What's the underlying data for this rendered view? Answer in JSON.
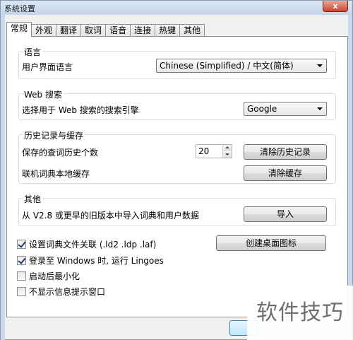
{
  "window": {
    "title": "系统设置",
    "close_glyph": "x"
  },
  "tabs": [
    {
      "label": "常规",
      "active": true
    },
    {
      "label": "外观",
      "active": false
    },
    {
      "label": "翻译",
      "active": false
    },
    {
      "label": "取词",
      "active": false
    },
    {
      "label": "语音",
      "active": false
    },
    {
      "label": "连接",
      "active": false
    },
    {
      "label": "热键",
      "active": false
    },
    {
      "label": "其他",
      "active": false
    }
  ],
  "language": {
    "group_title": "语言",
    "ui_language_label": "用户界面语言",
    "ui_language_value": "Chinese (Simplified)  /  中文(简体)"
  },
  "web_search": {
    "group_title": "Web 搜索",
    "engine_label": "选择用于 Web 搜索的搜索引擎",
    "engine_value": "Google"
  },
  "history": {
    "group_title": "历史记录与缓存",
    "history_count_label": "保存的查词历史个数",
    "history_count_value": "20",
    "clear_history_button": "清除历史记录",
    "cache_label": "联机词典本地缓存",
    "clear_cache_button": "清除缓存"
  },
  "other": {
    "group_title": "其他",
    "import_label": "从 V2.8 或更早的旧版本中导入词典和用户数据",
    "import_button": "导入"
  },
  "options": {
    "file_assoc_label": "设置词典文件关联 (.ld2 .ldp .laf)",
    "file_assoc_checked": true,
    "desktop_icon_button": "创建桌面图标",
    "run_on_login_label": "登录至 Windows 时, 运行 Lingoes",
    "run_on_login_checked": true,
    "minimize_label": "启动后最小化",
    "minimize_checked": false,
    "no_tips_label": "不显示信息提示窗口",
    "no_tips_checked": false
  },
  "watermark": "软件技巧"
}
